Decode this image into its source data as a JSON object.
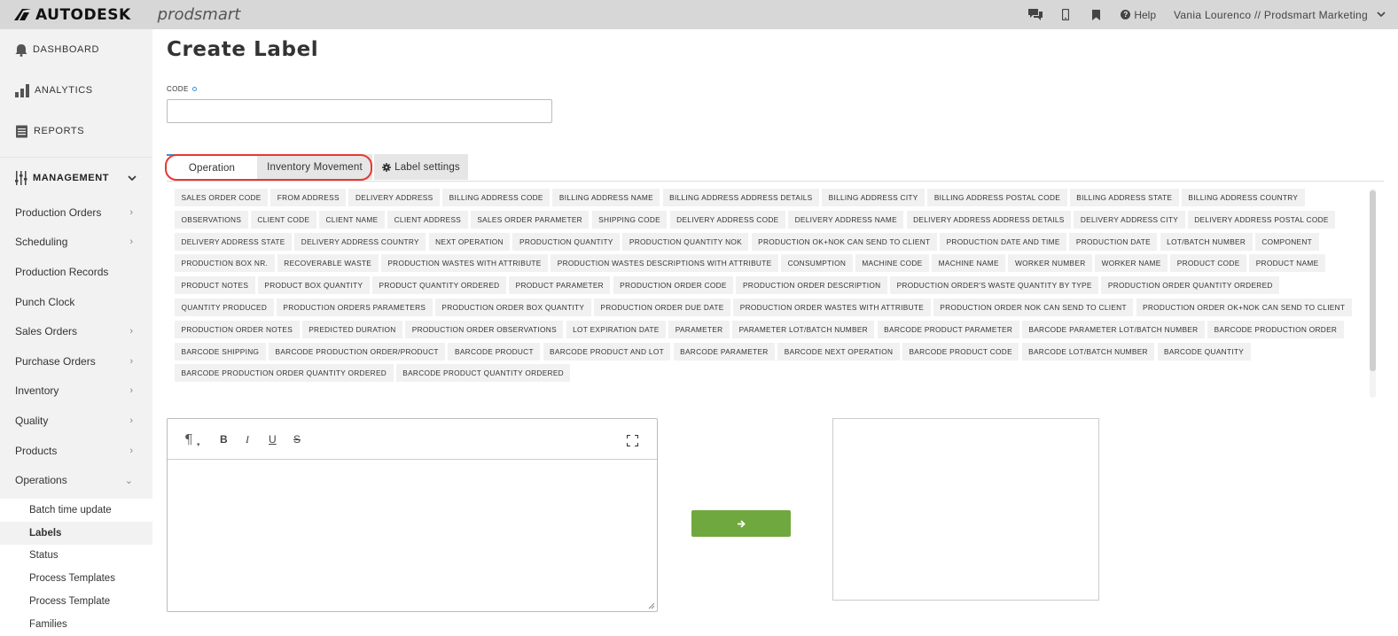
{
  "header": {
    "brand": "AUTODESK",
    "product": "prodsmart",
    "help_label": "Help",
    "user": "Vania Lourenco // Prodsmart Marketing"
  },
  "sidebar": {
    "top_items": [
      {
        "label": "DASHBOARD",
        "icon": "bell-icon"
      },
      {
        "label": "ANALYTICS",
        "icon": "bar-chart-icon"
      },
      {
        "label": "REPORTS",
        "icon": "document-icon"
      }
    ],
    "section": {
      "label": "MANAGEMENT",
      "icon": "sliders-icon"
    },
    "items": [
      {
        "label": "Production Orders",
        "arrow": "›"
      },
      {
        "label": "Scheduling",
        "arrow": "›"
      },
      {
        "label": "Production Records",
        "arrow": ""
      },
      {
        "label": "Punch Clock",
        "arrow": ""
      },
      {
        "label": "Sales Orders",
        "arrow": "›"
      },
      {
        "label": "Purchase Orders",
        "arrow": "›"
      },
      {
        "label": "Inventory",
        "arrow": "›"
      },
      {
        "label": "Quality",
        "arrow": "›"
      },
      {
        "label": "Products",
        "arrow": "›"
      },
      {
        "label": "Operations",
        "arrow": "⌄"
      }
    ],
    "sub_items": [
      {
        "label": "Batch time update",
        "active": false
      },
      {
        "label": "Labels",
        "active": true
      },
      {
        "label": "Status",
        "active": false
      },
      {
        "label": "Process Templates",
        "active": false
      },
      {
        "label": "Process Template",
        "active": false
      },
      {
        "label": "Families",
        "active": false
      }
    ]
  },
  "main": {
    "title": "Create Label",
    "code_label": "CODE",
    "code_value": "",
    "tabs": [
      {
        "label": "Operation",
        "active": true
      },
      {
        "label": "Inventory Movement",
        "active": false
      },
      {
        "label": "Label settings",
        "active": false,
        "icon": "gear-icon"
      }
    ],
    "tags": [
      "SALES ORDER CODE",
      "FROM ADDRESS",
      "DELIVERY ADDRESS",
      "BILLING ADDRESS CODE",
      "BILLING ADDRESS NAME",
      "BILLING ADDRESS ADDRESS DETAILS",
      "BILLING ADDRESS CITY",
      "BILLING ADDRESS POSTAL CODE",
      "BILLING ADDRESS STATE",
      "BILLING ADDRESS COUNTRY",
      "OBSERVATIONS",
      "CLIENT CODE",
      "CLIENT NAME",
      "CLIENT ADDRESS",
      "SALES ORDER PARAMETER",
      "SHIPPING CODE",
      "DELIVERY ADDRESS CODE",
      "DELIVERY ADDRESS NAME",
      "DELIVERY ADDRESS ADDRESS DETAILS",
      "DELIVERY ADDRESS CITY",
      "DELIVERY ADDRESS POSTAL CODE",
      "DELIVERY ADDRESS STATE",
      "DELIVERY ADDRESS COUNTRY",
      "NEXT OPERATION",
      "PRODUCTION QUANTITY",
      "PRODUCTION QUANTITY NOK",
      "PRODUCTION OK+NOK CAN SEND TO CLIENT",
      "PRODUCTION DATE AND TIME",
      "PRODUCTION DATE",
      "LOT/BATCH NUMBER",
      "COMPONENT",
      "PRODUCTION BOX NR.",
      "RECOVERABLE WASTE",
      "PRODUCTION WASTES WITH ATTRIBUTE",
      "PRODUCTION WASTES DESCRIPTIONS WITH ATTRIBUTE",
      "CONSUMPTION",
      "MACHINE CODE",
      "MACHINE NAME",
      "WORKER NUMBER",
      "WORKER NAME",
      "PRODUCT CODE",
      "PRODUCT NAME",
      "PRODUCT NOTES",
      "PRODUCT BOX QUANTITY",
      "PRODUCT QUANTITY ORDERED",
      "PRODUCT PARAMETER",
      "PRODUCTION ORDER CODE",
      "PRODUCTION ORDER DESCRIPTION",
      "PRODUCTION ORDER'S WASTE QUANTITY BY TYPE",
      "PRODUCTION ORDER QUANTITY ORDERED",
      "QUANTITY PRODUCED",
      "PRODUCTION ORDERS PARAMETERS",
      "PRODUCTION ORDER BOX QUANTITY",
      "PRODUCTION ORDER DUE DATE",
      "PRODUCTION ORDER WASTES WITH ATTRIBUTE",
      "PRODUCTION ORDER NOK CAN SEND TO CLIENT",
      "PRODUCTION ORDER OK+NOK CAN SEND TO CLIENT",
      "PRODUCTION ORDER NOTES",
      "PREDICTED DURATION",
      "PRODUCTION ORDER OBSERVATIONS",
      "LOT EXPIRATION DATE",
      "PARAMETER",
      "PARAMETER LOT/BATCH NUMBER",
      "BARCODE PRODUCT PARAMETER",
      "BARCODE PARAMETER LOT/BATCH NUMBER",
      "BARCODE PRODUCTION ORDER",
      "BARCODE SHIPPING",
      "BARCODE PRODUCTION ORDER/PRODUCT",
      "BARCODE PRODUCT",
      "BARCODE PRODUCT AND LOT",
      "BARCODE PARAMETER",
      "BARCODE NEXT OPERATION",
      "BARCODE PRODUCT CODE",
      "BARCODE LOT/BATCH NUMBER",
      "BARCODE QUANTITY",
      "BARCODE PRODUCTION ORDER QUANTITY ORDERED",
      "BARCODE PRODUCT QUANTITY ORDERED"
    ],
    "editor": {
      "tools": [
        {
          "name": "paragraph-format-icon",
          "glyph": "¶"
        },
        {
          "name": "bold-button",
          "glyph": "B"
        },
        {
          "name": "italic-button",
          "glyph": "I"
        },
        {
          "name": "underline-button",
          "glyph": "U"
        },
        {
          "name": "strikethrough-button",
          "glyph": "S"
        }
      ],
      "content": ""
    },
    "convert_button_icon": "arrow-right-icon",
    "accent_color": "#6fa83e"
  }
}
